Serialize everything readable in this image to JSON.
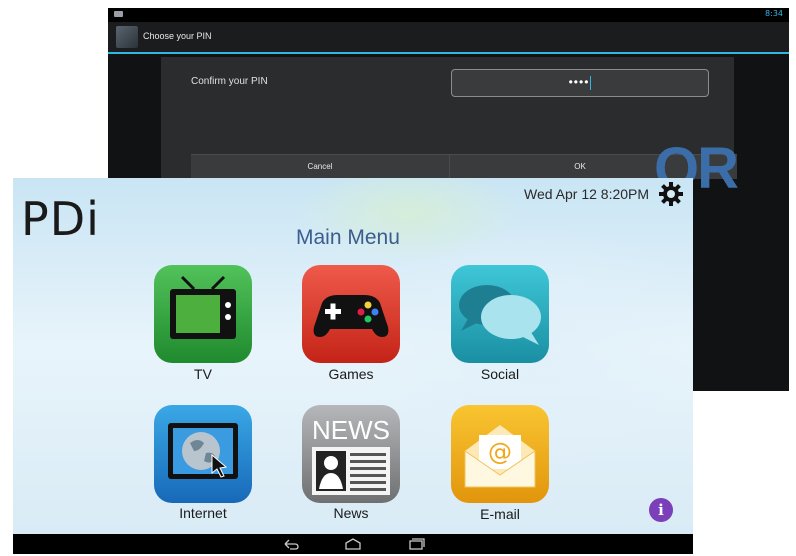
{
  "pin_screen": {
    "status_time": "8:34",
    "title": "Choose your PIN",
    "field_label": "Confirm your PIN",
    "pin_masked": "••••",
    "cancel_label": "Cancel",
    "ok_label": "OK",
    "accent_color": "#33b5e5"
  },
  "or_label": "OR",
  "menu_screen": {
    "logo": "PDi",
    "datetime": "Wed Apr 12  8:20PM",
    "title": "Main Menu",
    "tiles": [
      {
        "label": "TV",
        "icon": "tv-icon",
        "color": "#2ea33c"
      },
      {
        "label": "Games",
        "icon": "gamepad-icon",
        "color": "#e0392b"
      },
      {
        "label": "Social",
        "icon": "chat-bubbles-icon",
        "color": "#27a9bd"
      },
      {
        "label": "Internet",
        "icon": "globe-icon",
        "color": "#2183cf"
      },
      {
        "label": "News",
        "icon": "newspaper-icon",
        "color": "#8e9093",
        "icon_text": "NEWS"
      },
      {
        "label": "E-mail",
        "icon": "email-envelope-icon",
        "color": "#f0ae1d"
      }
    ],
    "info_symbol": "i",
    "nav_buttons": [
      "back-icon",
      "home-icon",
      "recent-apps-icon"
    ]
  }
}
